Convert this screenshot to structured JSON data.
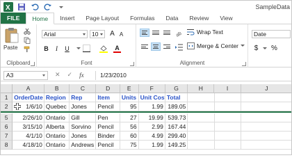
{
  "app": {
    "window_title": "SampleData",
    "brand_color": "#217346"
  },
  "tabs": [
    {
      "label": "FILE"
    },
    {
      "label": "Home"
    },
    {
      "label": "Insert"
    },
    {
      "label": "Page Layout"
    },
    {
      "label": "Formulas"
    },
    {
      "label": "Data"
    },
    {
      "label": "Review"
    },
    {
      "label": "View"
    }
  ],
  "ribbon": {
    "clipboard": {
      "paste_label": "Paste",
      "group_label": "Clipboard"
    },
    "font": {
      "font_name": "Arial",
      "font_size": "10",
      "group_label": "Font",
      "bold": "B",
      "italic": "I",
      "underline": "U",
      "grow": "A",
      "shrink": "A",
      "font_color": "A"
    },
    "alignment": {
      "wrap_text": "Wrap Text",
      "merge_center": "Merge & Center",
      "group_label": "Alignment"
    },
    "number": {
      "format": "Date",
      "currency": "$",
      "percent": "%"
    }
  },
  "formula_bar": {
    "name_box": "A3",
    "cancel": "✕",
    "enter": "✓",
    "fx": "fx",
    "value": "1/23/2010"
  },
  "grid": {
    "columns": [
      "A",
      "B",
      "C",
      "D",
      "E",
      "F",
      "G",
      "H",
      "I",
      "J"
    ],
    "rows": [
      {
        "num": "1",
        "cells": [
          "OrderDate",
          "Region",
          "Rep",
          "Item",
          "Units",
          "Unit Cost",
          "Total",
          "",
          "",
          ""
        ]
      },
      {
        "num": "2",
        "cells": [
          "1/6/10",
          "Quebec",
          "Jones",
          "Pencil",
          "95",
          "1.99",
          "189.05",
          "",
          "",
          ""
        ]
      },
      {
        "num": "5",
        "cells": [
          "2/26/10",
          "Ontario",
          "Gill",
          "Pen",
          "27",
          "19.99",
          "539.73",
          "",
          "",
          ""
        ]
      },
      {
        "num": "6",
        "cells": [
          "3/15/10",
          "Alberta",
          "Sorvino",
          "Pencil",
          "56",
          "2.99",
          "167.44",
          "",
          "",
          ""
        ]
      },
      {
        "num": "7",
        "cells": [
          "4/1/10",
          "Ontario",
          "Jones",
          "Binder",
          "60",
          "4.99",
          "299.40",
          "",
          "",
          ""
        ]
      },
      {
        "num": "8",
        "cells": [
          "4/18/10",
          "Ontario",
          "Andrews",
          "Pencil",
          "75",
          "1.99",
          "149.25",
          "",
          "",
          ""
        ]
      }
    ]
  }
}
